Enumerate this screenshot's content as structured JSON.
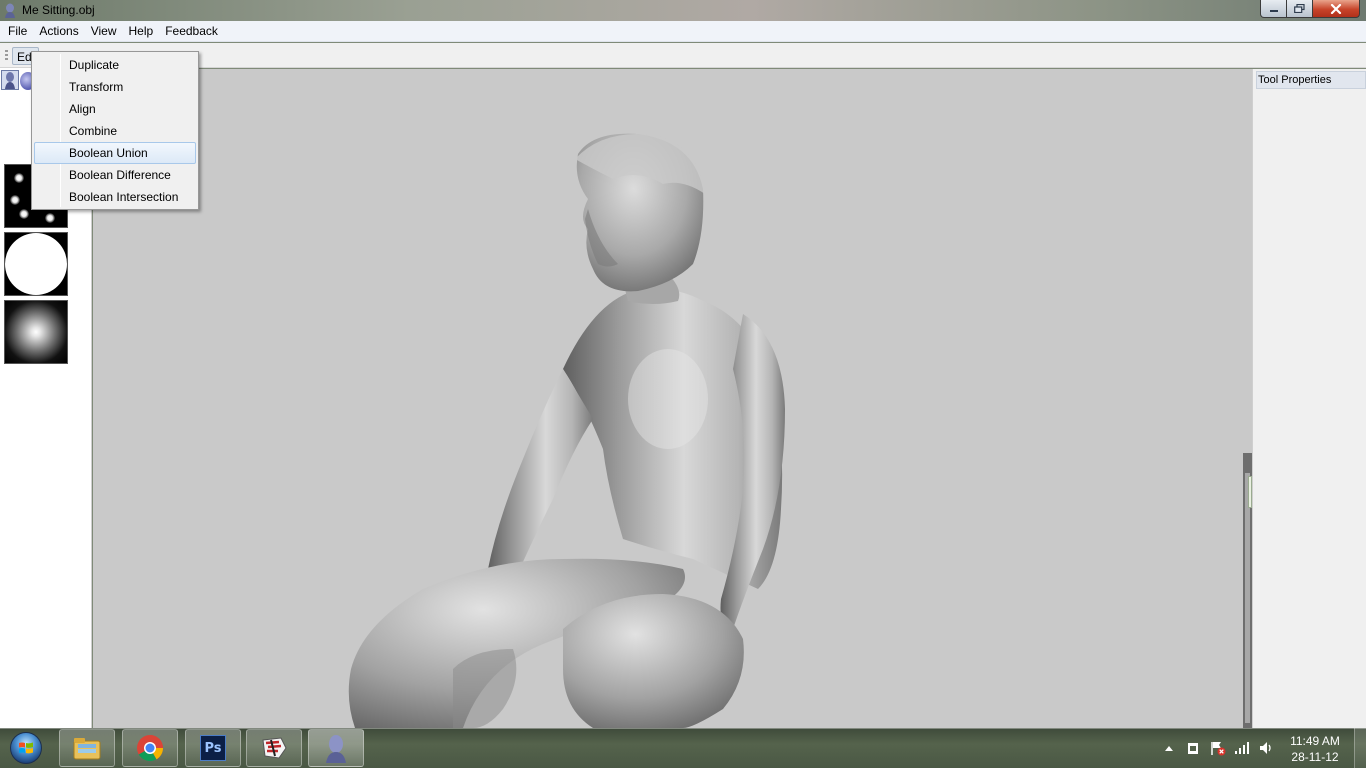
{
  "window": {
    "title": "Me Sitting.obj",
    "app_icon": "bust-icon",
    "controls": [
      "minimize-icon",
      "maximize-icon",
      "close-icon"
    ]
  },
  "menubar": {
    "items": [
      "File",
      "Actions",
      "View",
      "Help",
      "Feedback"
    ]
  },
  "toolbar": {
    "tab_label": "Edi"
  },
  "edit_menu": {
    "items": [
      {
        "label": "Duplicate",
        "highlighted": false
      },
      {
        "label": "Transform",
        "highlighted": false
      },
      {
        "label": "Align",
        "highlighted": false
      },
      {
        "label": "Combine",
        "highlighted": false
      },
      {
        "label": "Boolean Union",
        "highlighted": true
      },
      {
        "label": "Boolean Difference",
        "highlighted": false
      },
      {
        "label": "Boolean Intersection",
        "highlighted": false
      }
    ]
  },
  "left_panel": {
    "tools": [
      "sculpt-tool-icon",
      "sphere-tool-icon"
    ],
    "brushes": [
      "dots-brush",
      "solid-disc-brush",
      "soft-glow-brush"
    ]
  },
  "right_panel": {
    "title": "Tool Properties"
  },
  "viewport": {
    "background": "#c9c9c9",
    "model": "sitting-figure-mesh"
  },
  "taskbar": {
    "apps": [
      "windows-explorer",
      "google-chrome",
      "photoshop",
      "app-3d",
      "sculpt-app"
    ],
    "photoshop_label": "Ps",
    "tray_icons": [
      "show-hidden-icons",
      "device-icon",
      "action-center-flag-icon",
      "network-signal-icon",
      "volume-icon"
    ],
    "clock": {
      "time": "11:49 AM",
      "date": "28-11-12"
    }
  },
  "colors": {
    "menu_bg": "#f0f3f9",
    "viewport_bg": "#c9c9c9",
    "highlight_border": "#a8c8ea",
    "taskbar": "#4a5844"
  }
}
